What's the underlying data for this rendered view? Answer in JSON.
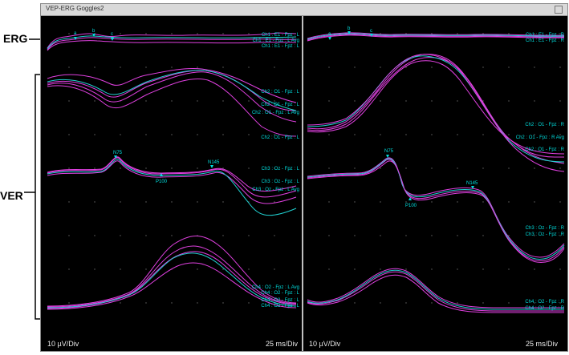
{
  "annotations": {
    "erg": "ERG",
    "ver": "VER"
  },
  "window": {
    "title": "VEP-ERG Goggles2"
  },
  "footer": {
    "left_scale": "10 µV/Div",
    "left_time": "25 ms/Div",
    "right_scale": "10 µV/Div",
    "right_time": "25 ms/Div"
  },
  "left_panel": {
    "erg_labels": [
      "Ch1 : E1 - Fpz : L",
      "Ch1 : E1 - Fpz : L Avg",
      "Ch1 : E1 - Fpz : L"
    ],
    "erg_peaks": [
      "a",
      "b",
      "c"
    ],
    "ch2_labels": [
      "Ch2 : O1 - Fpz : L",
      "Ch2 : O1 - Fpz : L",
      "Ch2 : O1 - Fpz : L Avg",
      "Ch2 : O1 - Fpz : L"
    ],
    "ch3_peaks": {
      "n75": "N75",
      "p100": "P100",
      "n145": "N145"
    },
    "ch3_labels": [
      "Ch3 : Oz - Fpz : L",
      "Ch3 : Oz - Fpz : L",
      "Ch3 : Oz - Fpz : L Avg"
    ],
    "ch4_labels": [
      "Ch4 : O2 - Fpz : L Avg",
      "Ch4 : O2 - Fpz : L",
      "Ch4 : O2 - Fpz : L",
      "Ch4 : O2 - Fpz : L"
    ]
  },
  "right_panel": {
    "erg_labels": [
      "Ch1 : E1 - Fpz : R",
      "Ch1 : E1 - Fpz : R"
    ],
    "erg_peaks": [
      "a",
      "b",
      "c"
    ],
    "ch2_labels": [
      "Ch2 : O1 - Fpz : R",
      "Ch2 : O1 - Fpz : R Avg",
      "Ch2 : O1 - Fpz : R"
    ],
    "ch3_peaks": {
      "n75": "N75",
      "p100": "P100",
      "n145": "N145"
    },
    "ch3_labels": [
      "Ch3 : Oz - Fpz : R",
      "Ch3 : Oz - Fpz : R"
    ],
    "ch4_labels": [
      "Ch4 : O2 - Fpz : R",
      "Ch4 : O2 - Fpz : R"
    ]
  },
  "colors": {
    "trace_individual": "#e040e0",
    "trace_average": "#20d0d0",
    "background": "#000000",
    "grid_dot": "#666666"
  }
}
